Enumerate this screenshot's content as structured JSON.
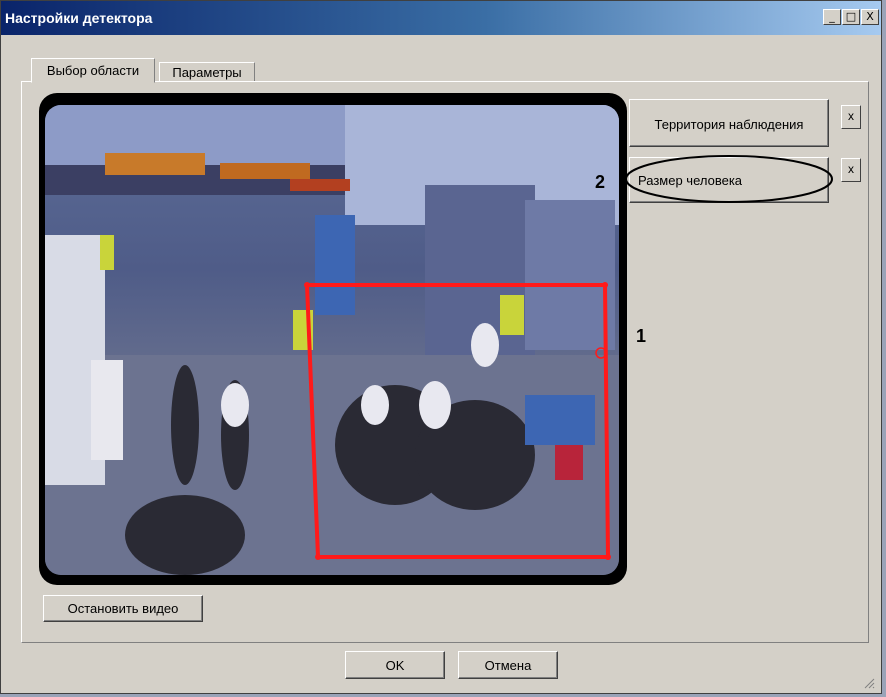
{
  "window": {
    "title": "Настройки детектора",
    "minimize": "_",
    "maximize": "□",
    "close": "X"
  },
  "tabs": [
    {
      "label": "Выбор области"
    },
    {
      "label": "Параметры"
    }
  ],
  "side_buttons": [
    {
      "label": "Территория наблюдения",
      "remove": "x"
    },
    {
      "label": "Размер человека",
      "remove": "x"
    }
  ],
  "annotations": {
    "first": "1",
    "second": "2"
  },
  "buttons": {
    "stop_video": "Остановить видео",
    "ok": "OK",
    "cancel": "Отмена"
  },
  "colors": {
    "selection": "#ff1a1a",
    "title_bar": "#0a246a"
  }
}
